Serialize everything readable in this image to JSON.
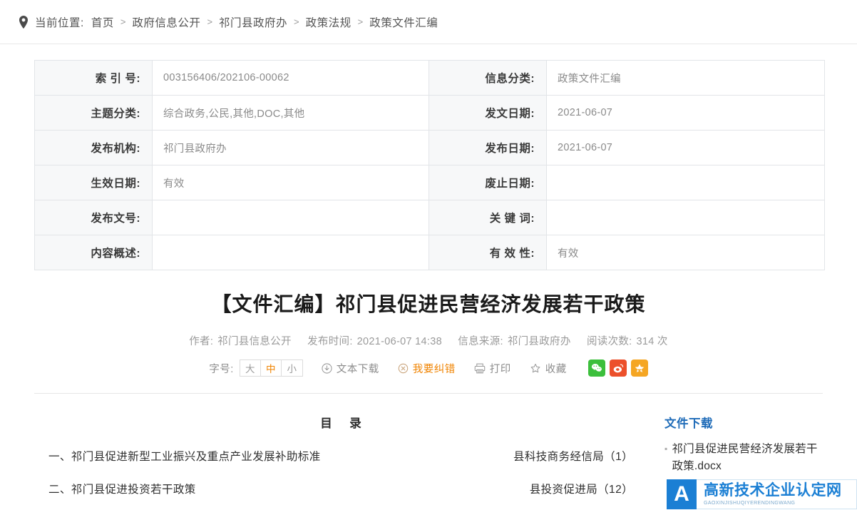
{
  "breadcrumb": {
    "icon": "map-pin-icon",
    "label": "当前位置:",
    "items": [
      "首页",
      "政府信息公开",
      "祁门县政府办",
      "政策法规",
      "政策文件汇编"
    ],
    "separator": ">"
  },
  "info_table": {
    "rows": [
      {
        "left_label": "索 引 号:",
        "left_value": "003156406/202106-00062",
        "right_label": "信息分类:",
        "right_value": "政策文件汇编"
      },
      {
        "left_label": "主题分类:",
        "left_value": "综合政务,公民,其他,DOC,其他",
        "right_label": "发文日期:",
        "right_value": "2021-06-07"
      },
      {
        "left_label": "发布机构:",
        "left_value": "祁门县政府办",
        "right_label": "发布日期:",
        "right_value": "2021-06-07"
      },
      {
        "left_label": "生效日期:",
        "left_value": "有效",
        "right_label": "废止日期:",
        "right_value": ""
      },
      {
        "left_label": "发布文号:",
        "left_value": "",
        "right_label": "关 键 词:",
        "right_value": ""
      },
      {
        "left_label": "内容概述:",
        "left_value": "",
        "right_label": "有 效 性:",
        "right_value": "有效"
      }
    ]
  },
  "article": {
    "title": "【文件汇编】祁门县促进民营经济发展若干政策",
    "meta": {
      "author_label": "作者:",
      "author_value": "祁门县信息公开",
      "publish_time_label": "发布时间:",
      "publish_time_value": "2021-06-07 14:38",
      "source_label": "信息来源:",
      "source_value": "祁门县政府办",
      "views_label": "阅读次数:",
      "views_value": "314 次"
    }
  },
  "toolbar": {
    "fontsize_label": "字号:",
    "fontsize_options": [
      {
        "label": "大",
        "active": false
      },
      {
        "label": "中",
        "active": true
      },
      {
        "label": "小",
        "active": false
      }
    ],
    "text_download": "文本下载",
    "report_error": "我要纠错",
    "print": "打印",
    "favorite": "收藏",
    "share": [
      {
        "name": "wechat-share-button",
        "title": "微信"
      },
      {
        "name": "weibo-share-button",
        "title": "微博"
      },
      {
        "name": "qzone-share-button",
        "title": "QQ空间"
      }
    ],
    "accent_color": "#f08300"
  },
  "content": {
    "toc_heading": "目 录",
    "toc_items": [
      {
        "text": "一、祁门县促进新型工业振兴及重点产业发展补助标准",
        "dept": "县科技商务经信局（1）"
      },
      {
        "text": "二、祁门县促进投资若干政策",
        "dept": "县投资促进局（12）"
      }
    ]
  },
  "sidebar": {
    "download_heading": "文件下载",
    "heading_color": "#1e6bb8",
    "files": [
      {
        "name": "祁门县促进民营经济发展若干政策.docx"
      }
    ]
  },
  "watermark": {
    "mark_letter": "A",
    "main_text": "高新技术企业认定网",
    "sub_text": "GAOXINJISHUQIYERENDINGWANG",
    "color": "#1b7fd4"
  }
}
